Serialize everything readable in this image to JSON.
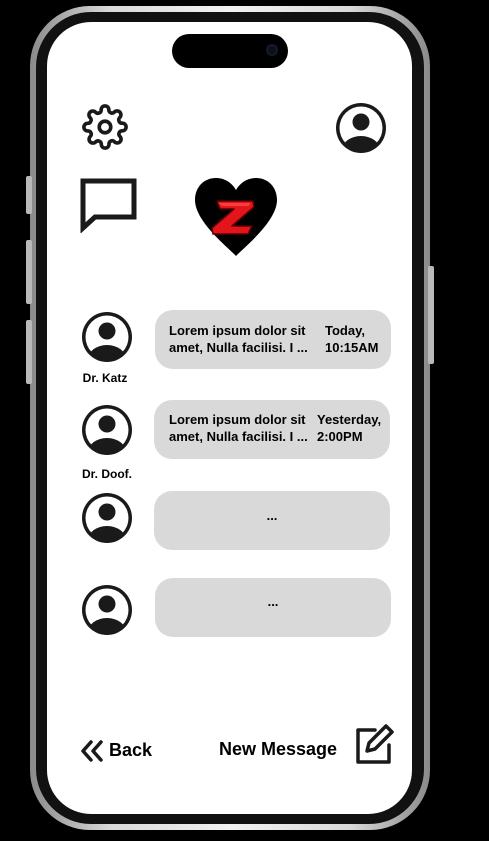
{
  "header": {
    "settings_icon": "gear-icon",
    "profile_icon": "user-circle-icon",
    "messages_icon": "chat-bubble-icon",
    "logo": {
      "letter": "Z",
      "heart_color": "#000000",
      "letter_color": "#e3141a"
    }
  },
  "conversations": [
    {
      "name": "Dr. Katz",
      "preview_line1": "Lorem ipsum dolor sit",
      "preview_line2": "amet, Nulla facilisi. I ...",
      "time_line1": "Today,",
      "time_line2": "10:15AM"
    },
    {
      "name": "Dr. Doof.",
      "preview_line1": "Lorem ipsum dolor sit",
      "preview_line2": "amet, Nulla facilisi. I ...",
      "time_line1": "Yesterday,",
      "time_line2": "2:00PM"
    },
    {
      "name": "",
      "preview": "..."
    },
    {
      "name": "",
      "preview": "..."
    }
  ],
  "footer": {
    "back_label": "Back",
    "new_message_label": "New Message"
  },
  "colors": {
    "screen_bg": "#ffffff",
    "bubble_bg": "#d9d9d9",
    "text": "#000000",
    "icon": "#1a1a1a"
  }
}
